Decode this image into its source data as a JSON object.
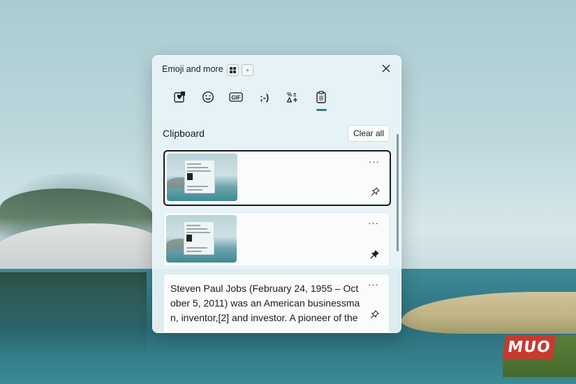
{
  "panel": {
    "title": "Emoji and more",
    "close_icon": "close-icon",
    "header_buttons": [
      "layout-icon",
      "keyboard-icon"
    ]
  },
  "tabs": [
    {
      "name": "favorites",
      "icon": "heart-sticker-icon",
      "active": false
    },
    {
      "name": "emoji",
      "icon": "smiley-icon",
      "active": false
    },
    {
      "name": "gif",
      "label": "GIF",
      "icon": "gif-icon",
      "active": false
    },
    {
      "name": "kaomoji",
      "label": ";-)",
      "icon": "kaomoji-icon",
      "active": false
    },
    {
      "name": "symbols",
      "icon": "symbols-icon",
      "active": false
    },
    {
      "name": "clipboard",
      "icon": "clipboard-icon",
      "active": true
    }
  ],
  "clipboard": {
    "title": "Clipboard",
    "clear_label": "Clear all",
    "items": [
      {
        "type": "image",
        "pinned": false,
        "selected": true,
        "more_label": "···"
      },
      {
        "type": "image",
        "pinned": true,
        "selected": false,
        "more_label": "···"
      },
      {
        "type": "text",
        "pinned": false,
        "selected": false,
        "more_label": "···",
        "text": "Steven Paul Jobs (February 24, 1955 – October 5, 2011) was an American businessman, inventor,[2] and investor. A pioneer of the"
      }
    ]
  },
  "watermark": "MUO",
  "colors": {
    "accent": "#3b7a84",
    "panel_bg": "#e8f4f8",
    "watermark_bg": "#c73a2f"
  }
}
